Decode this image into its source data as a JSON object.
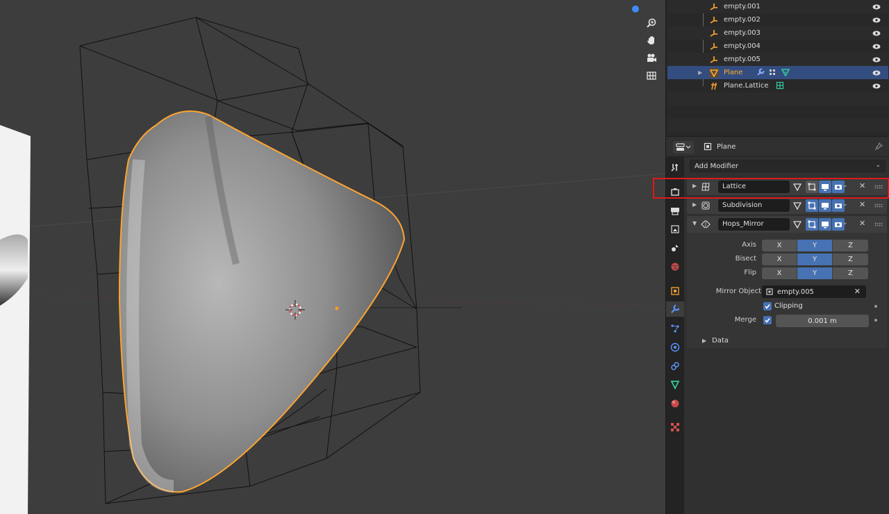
{
  "outliner": {
    "rows": [
      {
        "label": "empty.001"
      },
      {
        "label": "empty.002"
      },
      {
        "label": "empty.003"
      },
      {
        "label": "empty.004"
      },
      {
        "label": "empty.005"
      },
      {
        "label": "Plane"
      },
      {
        "label": "Plane.Lattice"
      }
    ]
  },
  "properties": {
    "object_name": "Plane",
    "add_modifier_label": "Add Modifier",
    "modifiers": [
      {
        "name": "Lattice",
        "icon": "lattice-icon",
        "highlighted": true
      },
      {
        "name": "Subdivision",
        "icon": "subdivision-icon"
      },
      {
        "name": "Hops_Mirror",
        "icon": "mirror-icon",
        "expanded": true
      }
    ],
    "mirror": {
      "axis_label": "Axis",
      "bisect_label": "Bisect",
      "flip_label": "Flip",
      "buttons": [
        "X",
        "Y",
        "Z"
      ],
      "active": "Y",
      "mirror_object_label": "Mirror Object",
      "mirror_object_value": "empty.005",
      "clipping_label": "Clipping",
      "merge_label": "Merge",
      "merge_value": "0.001 m",
      "data_label": "Data"
    }
  },
  "colors": {
    "selection_orange": "#ffaf29",
    "toggle_blue": "#4772b3",
    "highlight_red": "#e01818"
  }
}
